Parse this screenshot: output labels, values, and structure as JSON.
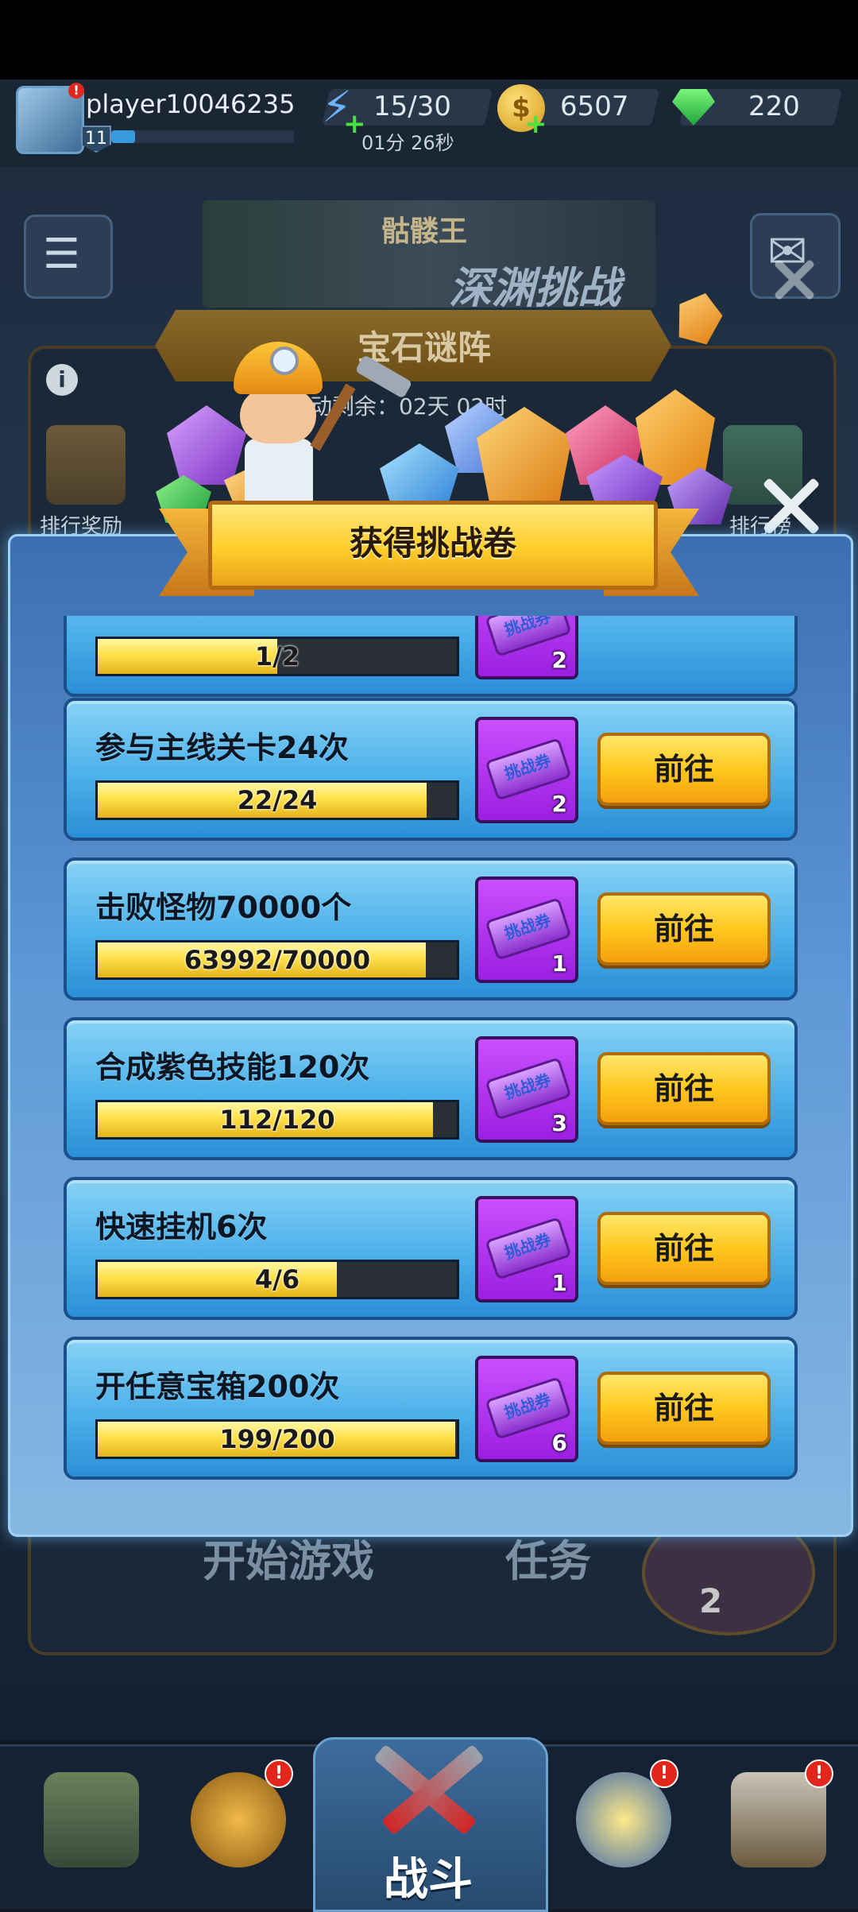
{
  "header": {
    "player_name": "player10046235",
    "level": "11",
    "avatar_alert": "!",
    "energy": "15/30",
    "energy_timer": "01分 26秒",
    "energy_plus": "+",
    "coins": "6507",
    "coin_symbol": "$",
    "coin_plus": "+",
    "gems": "220"
  },
  "background": {
    "banner_small": "骷髅王",
    "banner_big": "深渊挑战",
    "event_title": "宝石谜阵",
    "info_symbol": "i",
    "timer_text": "动剩余：02天 02时",
    "rank_reward_label": "排行奖励",
    "rank_label": "排行榜",
    "start_game": "开始游戏",
    "tasks": "任务",
    "ticket_count": "2"
  },
  "modal": {
    "title": "获得挑战卷",
    "ticket_label": "挑战券",
    "go_label": "前往",
    "tasks": [
      {
        "title": "",
        "progress_text": "1/2",
        "progress": 0.5,
        "reward": "2",
        "has_button": false
      },
      {
        "title": "参与主线关卡24次",
        "progress_text": "22/24",
        "progress": 0.917,
        "reward": "2",
        "has_button": true
      },
      {
        "title": "击败怪物70000个",
        "progress_text": "63992/70000",
        "progress": 0.914,
        "reward": "1",
        "has_button": true
      },
      {
        "title": "合成紫色技能120次",
        "progress_text": "112/120",
        "progress": 0.933,
        "reward": "3",
        "has_button": true
      },
      {
        "title": "快速挂机6次",
        "progress_text": "4/6",
        "progress": 0.667,
        "reward": "1",
        "has_button": true
      },
      {
        "title": "开任意宝箱200次",
        "progress_text": "199/200",
        "progress": 0.995,
        "reward": "6",
        "has_button": true
      }
    ]
  },
  "bottom_nav": {
    "battle_label": "战斗",
    "alert": "!"
  },
  "colors": {
    "accent_yellow": "#ffc81e",
    "panel_blue": "#4cb0ea",
    "reward_purple": "#9b1fe0"
  }
}
